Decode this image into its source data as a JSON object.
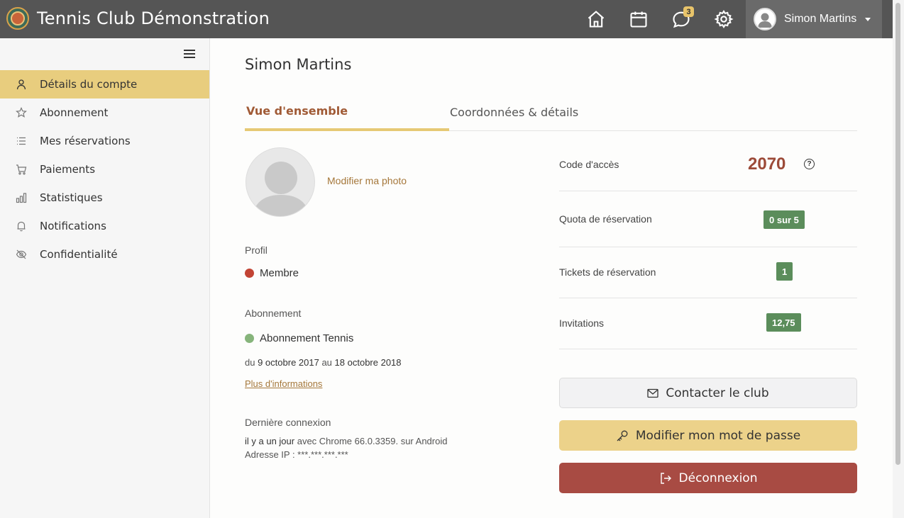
{
  "header": {
    "app_title": "Tennis Club Démonstration",
    "icons": [
      "home-icon",
      "calendar-icon",
      "chat-icon",
      "gear-icon"
    ],
    "chat_badge": "3",
    "user_name": "Simon Martins"
  },
  "sidebar": {
    "items": [
      {
        "label": "Détails du compte",
        "icon": "user-icon"
      },
      {
        "label": "Abonnement",
        "icon": "star-icon"
      },
      {
        "label": "Mes réservations",
        "icon": "list-icon"
      },
      {
        "label": "Paiements",
        "icon": "cart-icon"
      },
      {
        "label": "Statistiques",
        "icon": "bar-chart-icon"
      },
      {
        "label": "Notifications",
        "icon": "bell-icon"
      },
      {
        "label": "Confidentialité",
        "icon": "eye-off-icon"
      }
    ]
  },
  "main": {
    "title": "Simon Martins",
    "tabs": [
      "Vue d'ensemble",
      "Coordonnées & détails"
    ],
    "change_photo": "Modifier ma photo",
    "profile": {
      "label": "Profil",
      "value": "Membre"
    },
    "subscription": {
      "label": "Abonnement",
      "value": "Abonnement Tennis",
      "prefix": "du",
      "start": "9 octobre 2017",
      "middle": "au",
      "end": "18 octobre 2018",
      "more_link": "Plus d'informations"
    },
    "last_login": {
      "label": "Dernière connexion",
      "when": "il y a un jour",
      "detail": "avec Chrome 66.0.3359. sur Android",
      "ip": "Adresse IP : ***.***.***.***"
    }
  },
  "stats": {
    "access_code_label": "Code d'accès",
    "access_code": "2070",
    "quota_label": "Quota de réservation",
    "quota": "0 sur 5",
    "tickets_label": "Tickets de réservation",
    "tickets": "1",
    "invitations_label": "Invitations",
    "invitations": "12,75"
  },
  "buttons": {
    "contact": "Contacter le club",
    "password": "Modifier mon mot de passe",
    "logout": "Déconnexion"
  },
  "colors": {
    "topbar": "#555555",
    "accent": "#e8cd7e",
    "brown": "#a05a35",
    "green": "#5b8d5b",
    "red": "#a84b43"
  }
}
